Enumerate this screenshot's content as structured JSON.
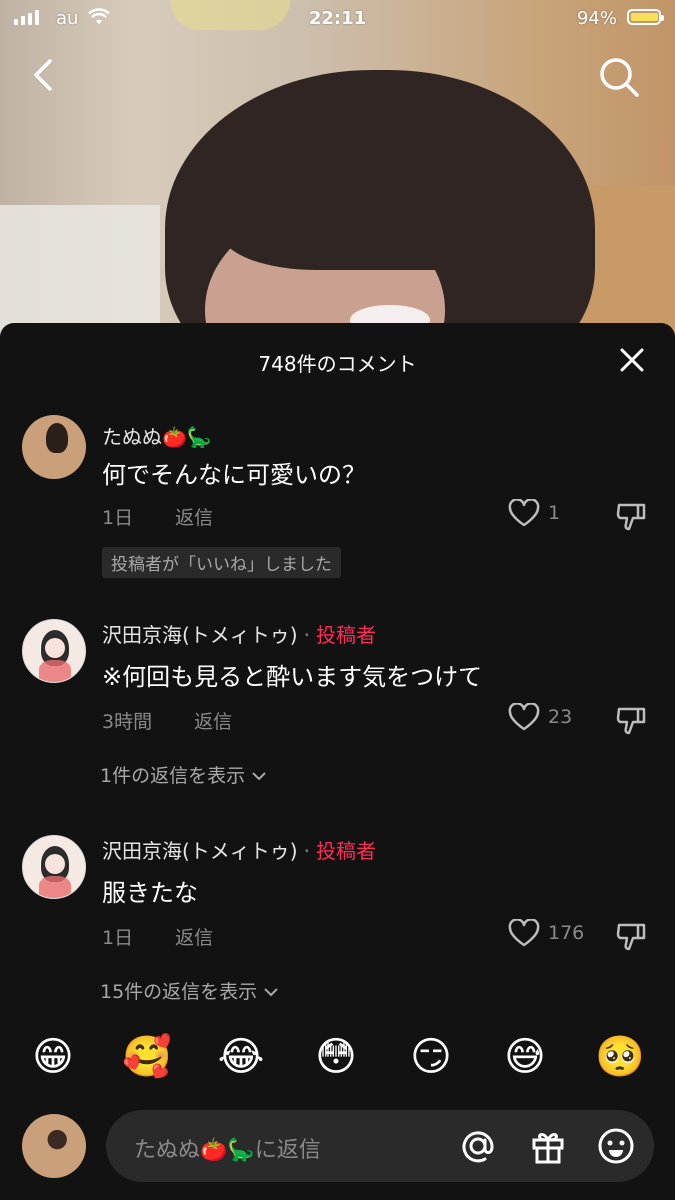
{
  "status_bar": {
    "carrier": "au",
    "time": "22:11",
    "battery": "94%",
    "battery_level": 0.94,
    "battery_color": "#f7df5b"
  },
  "top_nav": {
    "back_icon": "chevron-left-icon",
    "search_icon": "search-icon"
  },
  "comments_panel": {
    "title": "748件のコメント",
    "close_icon": "close-icon",
    "comments": [
      {
        "username": "たぬぬ🍅🦕",
        "text": "何でそんなに可愛いの？",
        "time": "1日",
        "reply_label": "返信",
        "like_count": "1",
        "liked_by_author_badge": "投稿者が「いいね」しました"
      },
      {
        "username": "沢田京海(トメィトゥ)",
        "author_label": "投稿者",
        "text": "※何回も見ると酔います気をつけて",
        "time": "3時間",
        "reply_label": "返信",
        "like_count": "23",
        "view_replies": "1件の返信を表示"
      },
      {
        "username": "沢田京海(トメィトゥ)",
        "author_label": "投稿者",
        "text": "服きたな",
        "time": "1日",
        "reply_label": "返信",
        "like_count": "176",
        "view_replies": "15件の返信を表示"
      }
    ],
    "author_color": "#fe2c55"
  },
  "emoji_bar": [
    "😁",
    "🥰",
    "😂",
    "😳",
    "😏",
    "😅",
    "🥺"
  ],
  "reply_input": {
    "placeholder": "たぬぬ🍅🦕に返信",
    "icons": [
      "at-icon",
      "gift-icon",
      "emoji-icon"
    ]
  }
}
